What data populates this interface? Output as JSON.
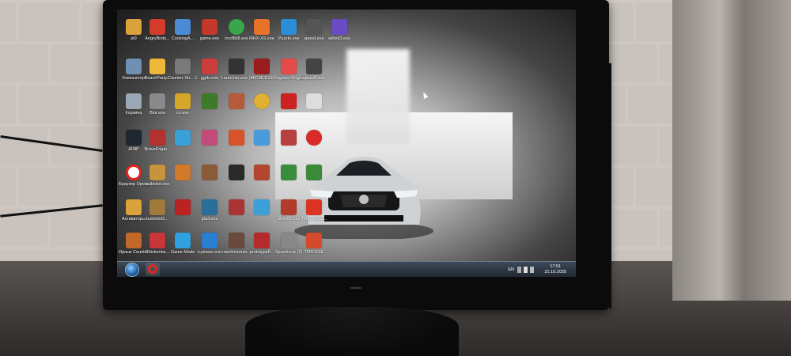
{
  "taskbar": {
    "language": "EN",
    "time": "17:51",
    "date": "21.10.2025"
  },
  "icons": [
    {
      "label": "pl0",
      "color": "#d9a23a"
    },
    {
      "label": "AngryBirds...",
      "color": "#d43b2a"
    },
    {
      "label": "CookingA...",
      "color": "#4b8bd6"
    },
    {
      "label": "game.exe",
      "color": "#c0392b"
    },
    {
      "label": "Incr8bl8.exe",
      "color": "#3aa64a"
    },
    {
      "label": "MHX-XS.exe",
      "color": "#e8722a"
    },
    {
      "label": "Puzzle.exe",
      "color": "#2a8fd6"
    },
    {
      "label": "speed.exe",
      "color": "#555555"
    },
    {
      "label": "wilbrd3.exe",
      "color": "#6a4bc4"
    },
    {
      "label": "Компьютер",
      "color": "#6f8fb3"
    },
    {
      "label": "BeachParty...",
      "color": "#f0b83a"
    },
    {
      "label": "Counter-Str... 1.6 (2)",
      "color": "#7a7a7a"
    },
    {
      "label": "ggdx.exe",
      "color": "#cc3d3d"
    },
    {
      "label": "Launcher.exe (2)",
      "color": "#333333"
    },
    {
      "label": "MICMI.EXE",
      "color": "#9a1d1d"
    },
    {
      "label": "Rayman Origins.exe",
      "color": "#e44a4a"
    },
    {
      "label": "speed2.exe",
      "color": "#444444"
    },
    {
      "label": "Корзина",
      "color": "#9aa7b5"
    },
    {
      "label": "Blur.exe",
      "color": "#8a8a8a"
    },
    {
      "label": "cs.exe",
      "color": "#d6a62a"
    },
    {
      "label": "",
      "color": "#3f7a2a"
    },
    {
      "label": "",
      "color": "#b55a3a"
    },
    {
      "label": "",
      "color": "#e0b030"
    },
    {
      "label": "",
      "color": "#c22"
    },
    {
      "label": "AIMP",
      "color": "#1f2730"
    },
    {
      "label": "BraveFrigat...",
      "color": "#b3322f"
    },
    {
      "label": "",
      "color": "#3aa0d8"
    },
    {
      "label": "",
      "color": "#c24b7a"
    },
    {
      "label": "",
      "color": "#d8532a"
    },
    {
      "label": "",
      "color": "#4a9bdc"
    },
    {
      "label": "",
      "color": "#b84040"
    },
    {
      "label": "",
      "color": "#d92b2b"
    },
    {
      "label": "Браузер Opera",
      "color": "#e52520"
    },
    {
      "label": "buildslot.exe",
      "color": "#c7933c"
    },
    {
      "label": "",
      "color": "#d07a2a"
    },
    {
      "label": "",
      "color": "#8a5a3a"
    },
    {
      "label": "",
      "color": "#2a2a2a"
    },
    {
      "label": "",
      "color": "#b3462f"
    },
    {
      "label": "",
      "color": "#3b8c3b"
    },
    {
      "label": "Активаторы",
      "color": "#d9a23a"
    },
    {
      "label": "buildslot2...",
      "color": "#a07a3a"
    },
    {
      "label": "",
      "color": "#b22"
    },
    {
      "label": "gta3.exe",
      "color": "#2a6e9a"
    },
    {
      "label": "",
      "color": "#a33"
    },
    {
      "label": "",
      "color": "#3c9fd8"
    },
    {
      "label": "",
      "color": "#2ba4d6"
    },
    {
      "label": "Shim82.exe",
      "color": "#b33b2b"
    },
    {
      "label": "TMOThreat...",
      "color": "#d32"
    },
    {
      "label": "Ярлык Counter-Str...",
      "color": "#c4682a"
    },
    {
      "label": "Chickenbe...",
      "color": "#c9363a"
    },
    {
      "label": "Game Mode",
      "color": "#2fa0e0"
    },
    {
      "label": "icytower.exe",
      "color": "#2a7fd0"
    },
    {
      "label": "machinarium...",
      "color": "#6a4a3a"
    },
    {
      "label": "prototypeF...",
      "color": "#b52a2a"
    },
    {
      "label": "Speed.exe (2)",
      "color": "#888888"
    },
    {
      "label": "TMO.EXE",
      "color": "#d44a2a"
    }
  ]
}
